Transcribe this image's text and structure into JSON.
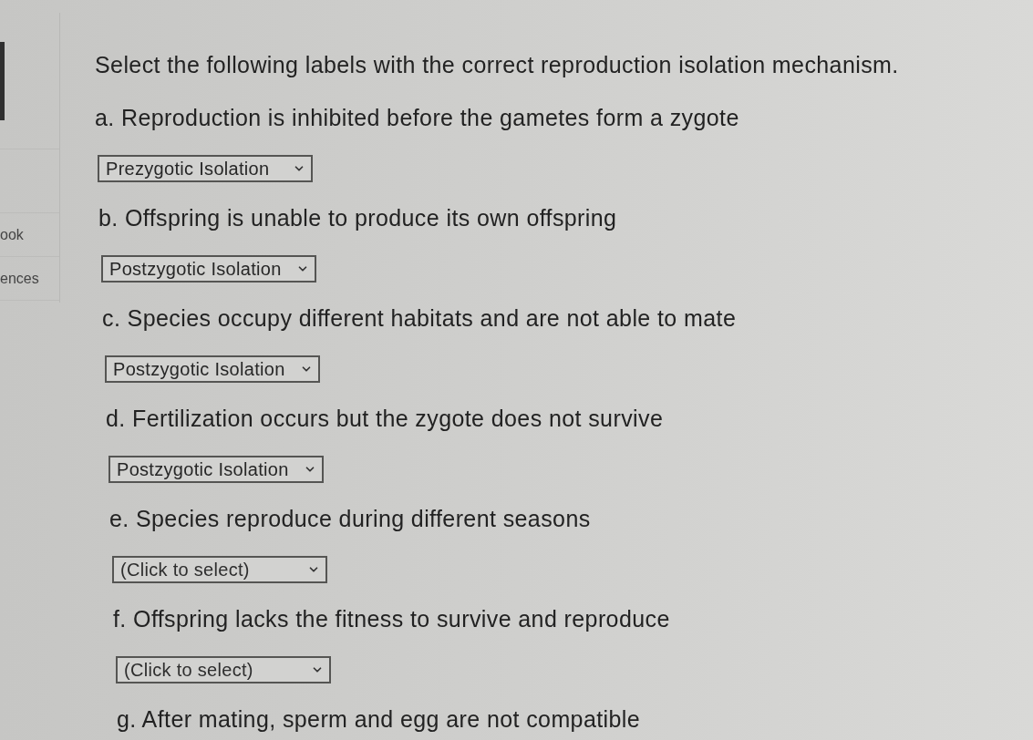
{
  "sidebar": {
    "items": [
      {
        "label": "ook"
      },
      {
        "label": "ences"
      }
    ]
  },
  "question": {
    "prompt": "Select the following labels with the correct reproduction isolation mechanism.",
    "items": [
      {
        "statement": "a. Reproduction is inhibited before the gametes form a zygote",
        "dropdown": {
          "value": "Prezygotic Isolation"
        }
      },
      {
        "statement": "b. Offspring is unable to produce its own offspring",
        "dropdown": {
          "value": "Postzygotic Isolation"
        }
      },
      {
        "statement": "c. Species occupy different habitats and are not able to mate",
        "dropdown": {
          "value": "Postzygotic Isolation"
        }
      },
      {
        "statement": "d. Fertilization occurs but the zygote does not survive",
        "dropdown": {
          "value": "Postzygotic Isolation"
        }
      },
      {
        "statement": "e. Species reproduce during different seasons",
        "dropdown": {
          "placeholder": "(Click to select)"
        }
      },
      {
        "statement": "f. Offspring lacks the fitness to survive and reproduce",
        "dropdown": {
          "placeholder": "(Click to select)"
        }
      },
      {
        "statement": "g. After mating, sperm and egg are not compatible"
      }
    ]
  }
}
